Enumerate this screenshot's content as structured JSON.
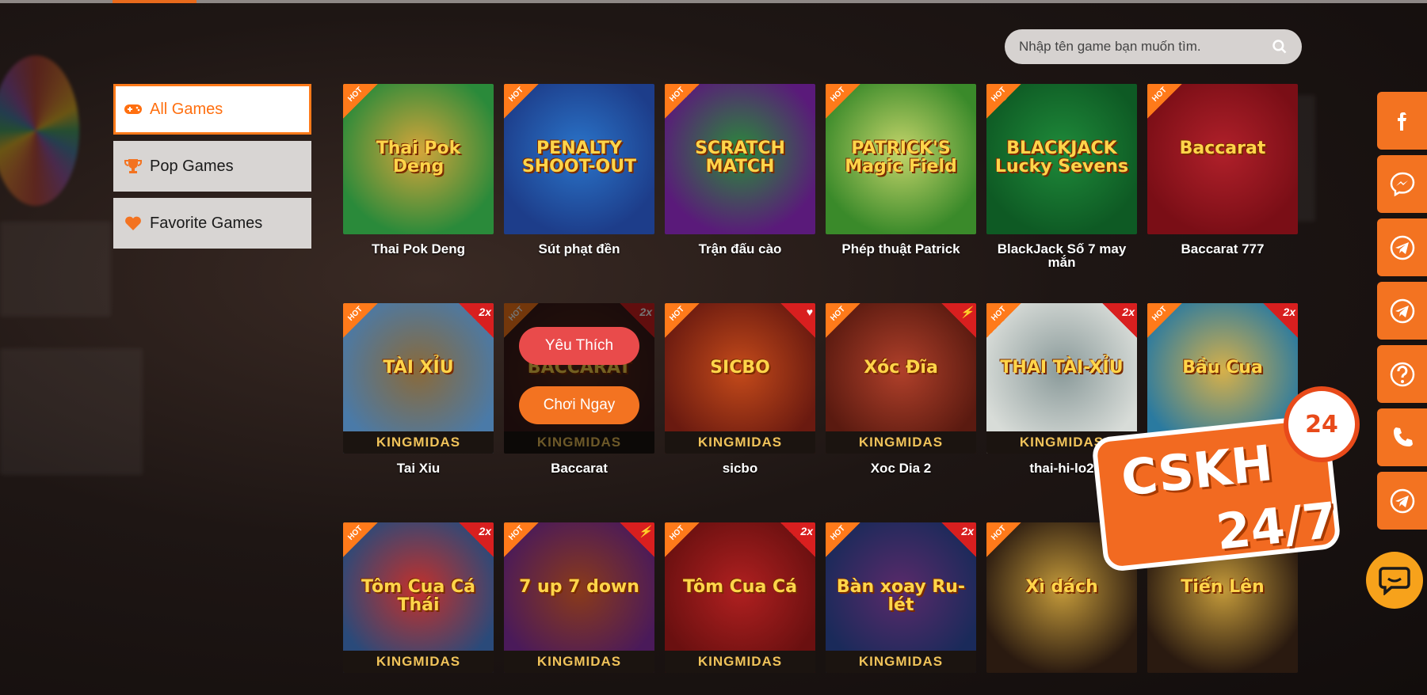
{
  "search": {
    "placeholder": "Nhập tên game bạn muốn tìm."
  },
  "sidebar": {
    "items": [
      {
        "label": "All Games",
        "icon": "gamepad-icon",
        "active": true
      },
      {
        "label": "Pop Games",
        "icon": "trophy-icon",
        "active": false
      },
      {
        "label": "Favorite Games",
        "icon": "heart-icon",
        "active": false
      }
    ]
  },
  "games": [
    {
      "name": "Thai Pok Deng",
      "art_title": "Thai Pok Deng",
      "badge": "HOT",
      "ribbon": "",
      "brand": "",
      "bg": [
        "#2a8a3a",
        "#d6a53a"
      ]
    },
    {
      "name": "Sút phạt đền",
      "art_title": "PENALTY SHOOT-OUT",
      "badge": "HOT",
      "ribbon": "",
      "brand": "",
      "bg": [
        "#1d3d8a",
        "#2a74c9"
      ]
    },
    {
      "name": "Trận đấu cào",
      "art_title": "SCRATCH MATCH",
      "badge": "HOT",
      "ribbon": "",
      "brand": "",
      "bg": [
        "#5a1a7a",
        "#2a8a3a"
      ]
    },
    {
      "name": "Phép thuật Patrick",
      "art_title": "PATRICK'S Magic Field",
      "badge": "HOT",
      "ribbon": "",
      "brand": "",
      "bg": [
        "#3a8a2a",
        "#c4d46a"
      ]
    },
    {
      "name": "BlackJack Số 7 may mắn",
      "art_title": "BLACKJACK Lucky Sevens",
      "badge": "HOT",
      "ribbon": "",
      "brand": "",
      "bg": [
        "#0e5a24",
        "#1f8a3a"
      ]
    },
    {
      "name": "Baccarat 777",
      "art_title": "Baccarat",
      "badge": "HOT",
      "ribbon": "",
      "brand": "",
      "bg": [
        "#7a0e16",
        "#b0202a"
      ]
    },
    {
      "name": "Tai Xiu",
      "art_title": "TÀI XỈU",
      "badge": "HOT",
      "ribbon": "2x",
      "brand": "KINGMIDAS",
      "bg": [
        "#4a7aa8",
        "#8a6a3a"
      ]
    },
    {
      "name": "Baccarat",
      "art_title": "BACCARAT",
      "badge": "HOT",
      "ribbon": "2x",
      "brand": "KINGMIDAS",
      "bg": [
        "#3a1a1a",
        "#5a2a1a"
      ],
      "hover": true
    },
    {
      "name": "sicbo",
      "art_title": "SICBO",
      "badge": "HOT",
      "ribbon": "♥",
      "brand": "KINGMIDAS",
      "bg": [
        "#6a1a10",
        "#c44a1a"
      ]
    },
    {
      "name": "Xoc Dia 2",
      "art_title": "Xóc Đĩa",
      "badge": "HOT",
      "ribbon": "⚡",
      "brand": "KINGMIDAS",
      "bg": [
        "#5a1a10",
        "#b0402a"
      ]
    },
    {
      "name": "thai-hi-lo2",
      "art_title": "THAI TÀI-XỈU",
      "badge": "HOT",
      "ribbon": "2x",
      "brand": "KINGMIDAS",
      "bg": [
        "#d8dcd8",
        "#8a9a9a"
      ]
    },
    {
      "name": "",
      "art_title": "Bầu Cua",
      "badge": "HOT",
      "ribbon": "2x",
      "brand": "",
      "bg": [
        "#2a7aa0",
        "#d6b04a"
      ]
    },
    {
      "name": "",
      "art_title": "Tôm Cua Cá Thái",
      "badge": "HOT",
      "ribbon": "2x",
      "brand": "KINGMIDAS",
      "bg": [
        "#2a4a7a",
        "#c4302a"
      ]
    },
    {
      "name": "",
      "art_title": "7 up 7 down",
      "badge": "HOT",
      "ribbon": "⚡",
      "brand": "KINGMIDAS",
      "bg": [
        "#4a1a5a",
        "#8a3a1a"
      ]
    },
    {
      "name": "",
      "art_title": "Tôm Cua Cá",
      "badge": "HOT",
      "ribbon": "2x",
      "brand": "KINGMIDAS",
      "bg": [
        "#6a1010",
        "#b02020"
      ]
    },
    {
      "name": "",
      "art_title": "Bàn xoay Ru-lét",
      "badge": "HOT",
      "ribbon": "2x",
      "brand": "KINGMIDAS",
      "bg": [
        "#1a2a5a",
        "#5a2a6a"
      ]
    },
    {
      "name": "",
      "art_title": "Xì dách",
      "badge": "HOT",
      "ribbon": "",
      "brand": "",
      "bg": [
        "#2a1a10",
        "#c49a3a"
      ]
    },
    {
      "name": "",
      "art_title": "Tiến Lên",
      "badge": "",
      "ribbon": "",
      "brand": "",
      "bg": [
        "#2a1a10",
        "#c49a3a"
      ]
    }
  ],
  "hover_card": {
    "favorite_label": "Yêu Thích",
    "play_label": "Chơi Ngay"
  },
  "socials": [
    "facebook-icon",
    "messenger-icon",
    "telegram-icon",
    "telegram-icon",
    "help-icon",
    "phone-icon",
    "telegram-icon"
  ],
  "cskh": {
    "line1": "CSKH",
    "line2": "24/7",
    "clock": "24"
  },
  "colors": {
    "accent": "#f37321",
    "active_text": "#ff6f0f",
    "favorite": "#e94b4b"
  }
}
